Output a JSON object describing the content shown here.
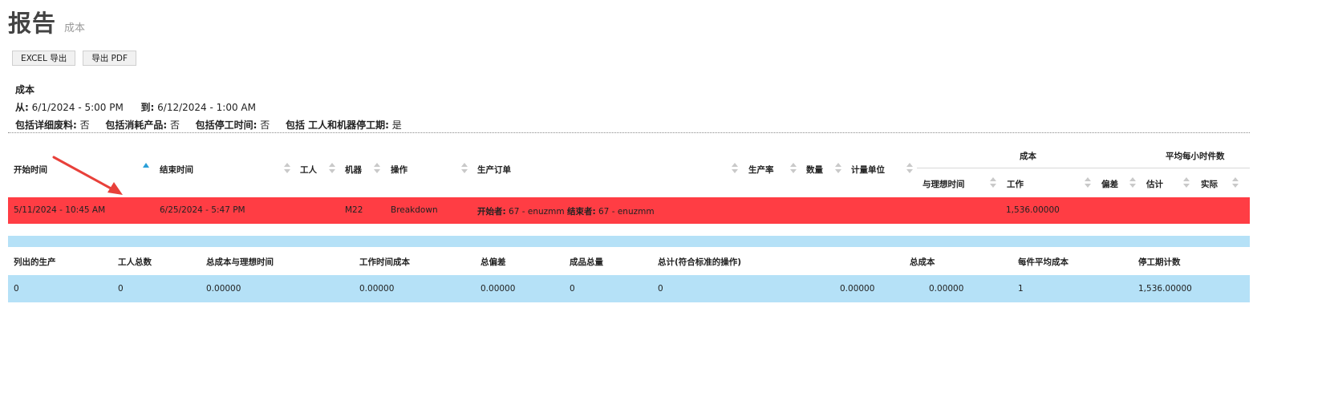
{
  "header": {
    "title": "报告",
    "subtitle": "成本"
  },
  "toolbar": {
    "excel_label": "EXCEL 导出",
    "pdf_label": "导出 PDF"
  },
  "params": {
    "heading": "成本",
    "from_label": "从:",
    "from_value": "6/1/2024 - 5:00 PM",
    "to_label": "到:",
    "to_value": "6/12/2024 - 1:00 AM",
    "detail_scrap_label": "包括详细废料:",
    "detail_scrap_value": "否",
    "consumables_label": "包括消耗产品:",
    "consumables_value": "否",
    "downtime_label": "包括停工时间:",
    "downtime_value": "否",
    "worker_machine_label": "包括 工人和机器停工期:",
    "worker_machine_value": "是"
  },
  "table": {
    "columns": {
      "start_time": "开始时间",
      "end_time": "结束时间",
      "worker": "工人",
      "machine": "机器",
      "operation": "操作",
      "production_order": "生产订单",
      "production_rate": "生产率",
      "quantity": "数量",
      "unit": "计量单位"
    },
    "groups": {
      "cost": "成本",
      "avg_per_hour": "平均每小时件数"
    },
    "subcolumns": {
      "vs_ideal_time": "与理想时间",
      "work": "工作",
      "deviation": "偏差",
      "estimate": "估计",
      "actual": "实际"
    },
    "rows": [
      {
        "start_time": "5/11/2024 - 10:45 AM",
        "end_time": "6/25/2024 - 5:47 PM",
        "machine": "M22",
        "operation": "Breakdown",
        "started_by_label": "开始者:",
        "started_by": "67 - enuzmm",
        "ended_by_label": "结束者:",
        "ended_by": "67 - enuzmm",
        "work": "1,536.00000"
      }
    ]
  },
  "summary": {
    "headers": {
      "listed_production": "列出的生产",
      "total_workers": "工人总数",
      "total_cost_vs_ideal": "总成本与理想时间",
      "work_time_cost": "工作时间成本",
      "total_deviation": "总偏差",
      "total_finished": "成品总量",
      "total_std_ops": "总计(符合标准的操作)",
      "total_cost": "总成本",
      "avg_cost_per_piece": "每件平均成本",
      "downtime_count": "停工期计数"
    },
    "values": {
      "listed_production": "0",
      "total_workers": "0",
      "total_cost_vs_ideal": "0.00000",
      "work_time_cost": "0.00000",
      "total_deviation": "0.00000",
      "total_finished": "0",
      "total_std_ops": "0",
      "extra": "0.00000",
      "total_cost": "0.00000",
      "avg_cost_per_piece": "1",
      "downtime_count": "1,536.00000"
    }
  },
  "colors": {
    "highlight_row": "#ff3d44",
    "summary_bg": "#b5e1f7",
    "sort_active": "#2a9fd8",
    "annotation_arrow": "#e8403a"
  }
}
